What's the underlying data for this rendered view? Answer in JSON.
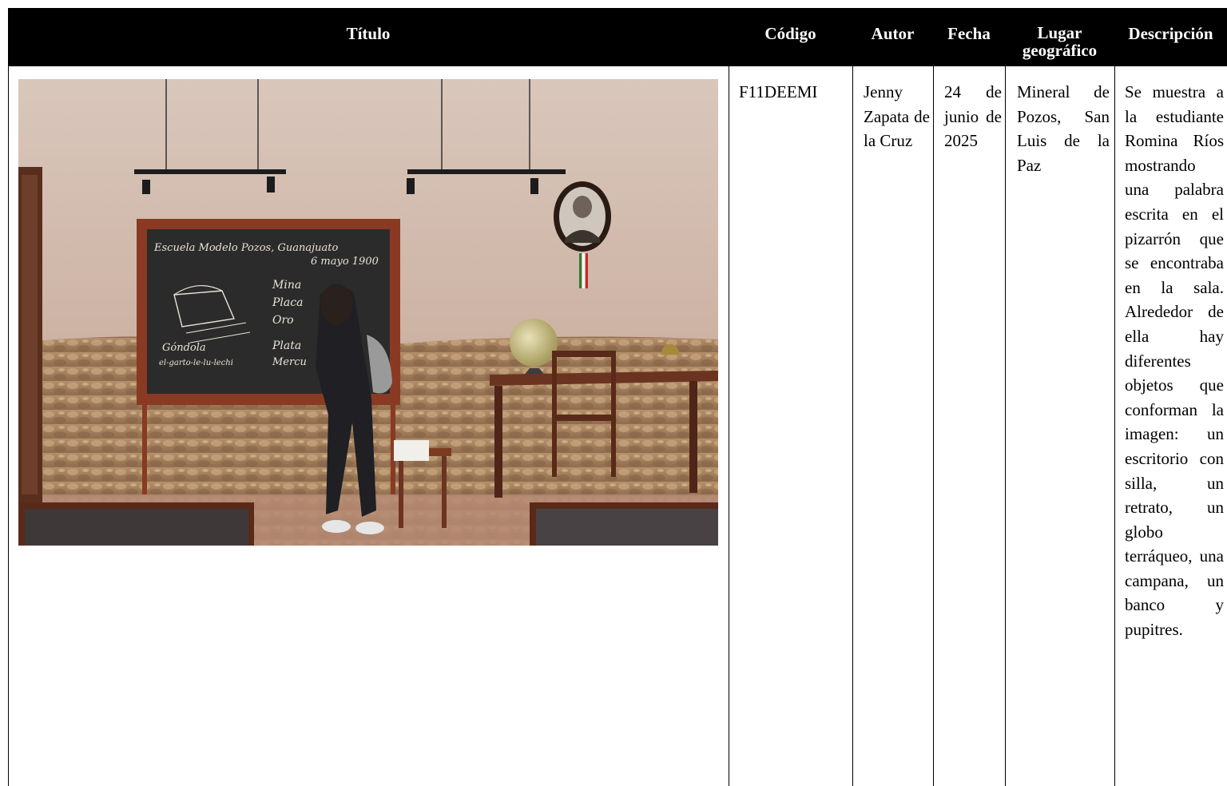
{
  "table": {
    "headers": {
      "titulo": "Título",
      "codigo": "Código",
      "autor": "Autor",
      "fecha": "Fecha",
      "lugar": "Lugar geográfico",
      "descripcion": "Descripción"
    },
    "row": {
      "photo_alt": "Fotografía",
      "chalkboard": {
        "line1": "Escuela Modelo  Pozos, Guanajuato",
        "line2": "6 mayo 1900",
        "words": [
          "Mina",
          "Placa",
          "Oro",
          "Plata",
          "Mercu"
        ],
        "caption1": "Góndola",
        "caption2": "el-garto-le-lu-lechi"
      },
      "codigo": "F11DEEMI",
      "autor": "Jenny Zapata de la Cruz",
      "fecha": "24 de junio de 2025",
      "lugar": "Mineral de Pozos, San Luis de la Paz",
      "descripcion": "Se muestra a la estudiante Romina Ríos mostrando una palabra escrita en el pizarrón que se encontraba en la sala. Alrededor de ella hay diferentes objetos que conforman la imagen: un escritorio con silla, un retrato, un globo terráqueo, una campana, un banco y pupitres."
    }
  }
}
